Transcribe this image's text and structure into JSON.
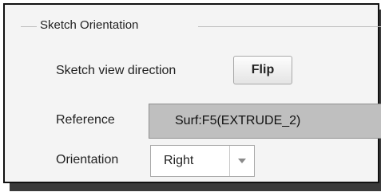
{
  "group": {
    "title": "Sketch Orientation"
  },
  "sketch_view_direction": {
    "label": "Sketch view direction",
    "button_label": "Flip"
  },
  "reference": {
    "label": "Reference",
    "value": "Surf:F5(EXTRUDE_2)"
  },
  "orientation": {
    "label": "Orientation",
    "selected": "Right",
    "arrow_icon": "chevron-down-icon"
  },
  "colors": {
    "reference_bg": "#bfbfbf",
    "panel_bg": "#f4f4f4",
    "border": "#111111",
    "shadow": "#3a3a3a"
  }
}
